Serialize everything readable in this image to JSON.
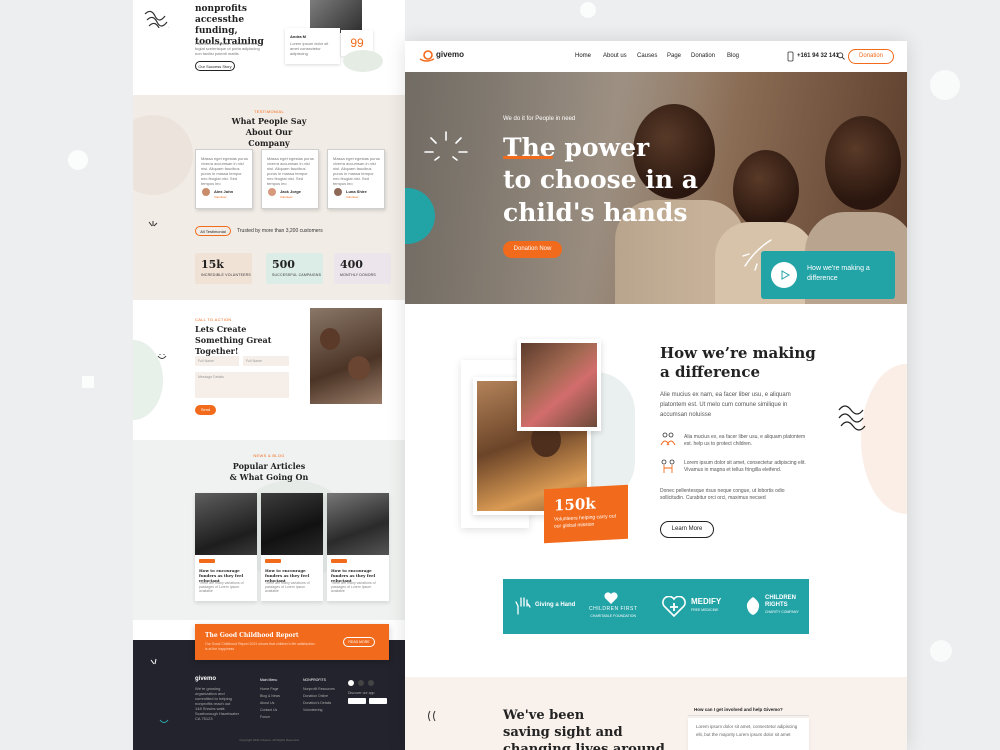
{
  "left": {
    "top_heading": "nonprofits accessthe funding, tools,training",
    "top_body": "Faucibus accumsan sollicitudin arcu fugiat scelerisque ut porta adipiscing non facilisi potenti mattis",
    "top_button": "Our Success Story",
    "quote_name": "Andra M",
    "quote_text": "Lorem ipsum dolor sit amet consectetur adipiscing",
    "quote_mark": "99",
    "testimonials": {
      "eyebrow": "TESTIMONIAL",
      "heading": "What People Say About Our Company",
      "cards": [
        {
          "text": "Massa eget egestas purus viverra accumsan in nisl nisi. Aliquam faucibus purus in massa tempor nec feugiat nisi. Sed tempus leo",
          "name": "Alex John",
          "role": "Volunteer"
        },
        {
          "text": "Massa eget egestas purus viverra accumsan in nisl nisi. Aliquam faucibus purus in massa tempor nec feugiat nisi. Sed tempus leo",
          "name": "Jack Jorge",
          "role": "Volunteer"
        },
        {
          "text": "Massa eget egestas purus viverra accumsan in nisl nisi. Aliquam faucibus purus in massa tempor nec feugiat nisi. Sed tempus leo",
          "name": "Luna Shire",
          "role": "Volunteer"
        }
      ],
      "all_button": "All Testimonial",
      "trusted": "Trusted by more than 3,200 customers"
    },
    "stats": [
      {
        "value": "15k",
        "label": "INCREDIBLE VOLUNTEERS"
      },
      {
        "value": "500",
        "label": "SUCCESSFUL CAMPAIGNS"
      },
      {
        "value": "400",
        "label": "MONTHLY DONORS"
      }
    ],
    "cta": {
      "eyebrow": "CALL TO ACTION",
      "heading": "Lets Create Something Great Together!",
      "ph_first": "Full Name",
      "ph_last": "Full Name",
      "ph_message": "Message Details",
      "send": "Send"
    },
    "articles": {
      "eyebrow": "NEWS & BLOG",
      "heading": "Popular Articles & What Going On",
      "items": [
        {
          "title": "How to encourage funders as they feel reluctant",
          "excerpt": "There are many variations of passages of Lorem Ipsum available"
        },
        {
          "title": "How to encourage funders as they feel reluctant",
          "excerpt": "There are many variations of passages of Lorem Ipsum available"
        },
        {
          "title": "How to encourage funders as they feel reluctant",
          "excerpt": "There are many variations of passages of Lorem Ipsum available"
        }
      ]
    },
    "report": {
      "title": "The Good Childhood Report",
      "text": "Our Good Childhood Report 2021 shows that children's life satisfaction is at the happiness",
      "button": "READ MORE"
    },
    "footer": {
      "logo": "givemo",
      "about": "We're growing organization and committed to helping nonprofits reach out",
      "address": "148 Shrubs walk Scarborough Hazelwater CA 75123",
      "col1_title": "Main Menu",
      "col1": [
        "Home Page",
        "Blog & News",
        "About Us",
        "Contact Us",
        "Forum"
      ],
      "col2_title": "NONPROFITS",
      "col2": [
        "Nonprofit Resources",
        "Donation Online",
        "Donation's Details",
        "Volunteering"
      ],
      "app_label": "Discover our app",
      "copyright": "Copyright 2021 Givemo. All Rights Reserved"
    }
  },
  "right": {
    "logo": "givemo",
    "nav": [
      "Home",
      "About us",
      "Causes",
      "Page",
      "Donation",
      "Blog"
    ],
    "phone": "+161 94 32 141",
    "donation_button": "Donation",
    "hero": {
      "eyebrow": "We do it for People in need",
      "line1": "The power",
      "line2": "to choose in a",
      "line3": "child's hands",
      "button": "Donation Now",
      "video_label": "How we're making a difference"
    },
    "about": {
      "heading": "How we’re making a difference",
      "body": "Alie mucius ex nam, ea facer liber usu, e aliquam platontem est. Ut melo cum comune similique in accumsan noluisse",
      "features": [
        "Alia mucius ex, ea facer liber usu, e aliquam platontem est. help us to protect children.",
        "Lorem ipsum dolor sit amet, consectetur adipiscing elit. Vivamus in magna et tellus fringilla eleifend."
      ],
      "body2": "Donec pellentesque risus neque congue, ut lobortis odio sollicitudin. Curabitur orci orci, maximus necsed",
      "button": "Learn More",
      "stat_value": "150k",
      "stat_label": "Volunteers helping carry out our global mission"
    },
    "partners": [
      {
        "name": "Giving a Hand",
        "sub": ""
      },
      {
        "name": "CHILDREN FIRST",
        "sub": "CHARITABLE FOUNDATION"
      },
      {
        "name": "MEDIFY",
        "sub": "FREE MEDICINE"
      },
      {
        "name": "CHILDREN RIGHTS",
        "sub": "CHARITY COMPANY"
      }
    ],
    "bottom": {
      "heading_l1": "We've been",
      "heading_l2": "saving sight and",
      "heading_l3": "changing lives around",
      "faq_q": "How can I get involved and help Givemo?",
      "faq_a": "Lorem ipsum dolor sit amet, consectetur adipiscing elit, but the majority Lorem ipsum dolor sit amet"
    }
  },
  "colors": {
    "accent": "#f26a1b",
    "teal": "#22a3a6",
    "dark": "#23232d"
  }
}
